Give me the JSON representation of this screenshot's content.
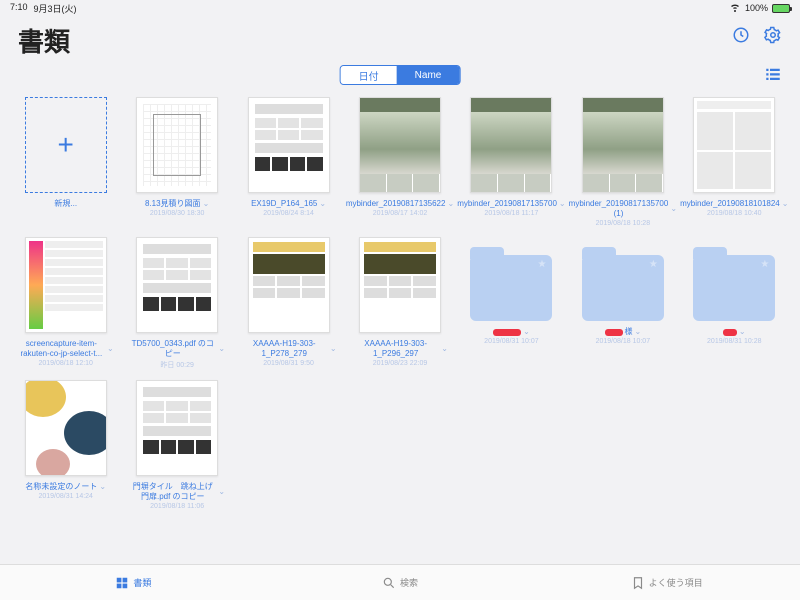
{
  "status": {
    "time": "7:10",
    "date": "9月3日(火)",
    "battery": "100%"
  },
  "header": {
    "title": "書類"
  },
  "segmented": {
    "left": "日付",
    "right": "Name"
  },
  "row1": [
    {
      "kind": "new",
      "label": "新規..."
    },
    {
      "kind": "plan",
      "label": "8.13見積り図面",
      "sub": "2019/08/30 18:30"
    },
    {
      "kind": "lines",
      "label": "EX19D_P164_165",
      "sub": "2019/08/24 8:14"
    },
    {
      "kind": "photo",
      "label": "mybinder_20190817135622",
      "sub": "2019/08/17 14:02"
    },
    {
      "kind": "photo",
      "label": "mybinder_20190817135700",
      "sub": "2019/08/18 11:17"
    },
    {
      "kind": "photo",
      "label": "mybinder_20190817135700 (1)",
      "sub": "2019/08/18 10:28"
    },
    {
      "kind": "page",
      "label": "mybinder_20190818101824",
      "sub": "2019/08/18 10:40"
    }
  ],
  "row2": [
    {
      "kind": "sidecat",
      "label": "screencapture-item-rakuten-co-jp-select-t...",
      "sub": "2019/08/18 12:10"
    },
    {
      "kind": "lines",
      "label": "TD5700_0343.pdf のコピー",
      "sub": "昨日 00:29"
    },
    {
      "kind": "catalog",
      "label": "XAAAA-H19-303-1_P278_279",
      "sub": "2019/08/31 9:50"
    },
    {
      "kind": "catalog",
      "label": "XAAAA-H19-303-1_P296_297",
      "sub": "2019/08/23 22:09"
    },
    {
      "kind": "folder",
      "sub": "2019/08/31 10:07",
      "redW": 28
    },
    {
      "kind": "folder",
      "label": "様",
      "sub": "2019/08/18 10:07",
      "redW": 18
    },
    {
      "kind": "folder",
      "sub": "2019/08/31 10:28",
      "redW": 14
    }
  ],
  "row3": [
    {
      "kind": "note",
      "label": "名称未設定のノート",
      "sub": "2019/08/31 14:24"
    },
    {
      "kind": "lines",
      "label": "門塀タイル　跳ね上げ門扉.pdf のコピー",
      "sub": "2019/08/18 11:06"
    }
  ],
  "tabs": {
    "docs": "書類",
    "search": "検索",
    "fav": "よく使う項目"
  }
}
